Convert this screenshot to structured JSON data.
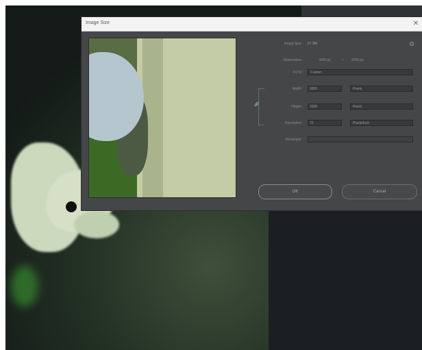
{
  "dialog": {
    "title": "Image Size",
    "close_glyph": "✕",
    "gear_glyph": "⚙",
    "rows": {
      "image_size": {
        "label": "Image Size:",
        "value": "57.9M"
      },
      "dimensions": {
        "label": "Dimensions:",
        "width": "3000 px",
        "times": "×",
        "height": "2000 px"
      },
      "fit_to": {
        "label": "Fit To:",
        "value": "Custom"
      },
      "width": {
        "label": "Width:",
        "value": "3000",
        "unit": "Pixels"
      },
      "height": {
        "label": "Height:",
        "value": "2000",
        "unit": "Pixels"
      },
      "resolution": {
        "label": "Resolution:",
        "value": "72",
        "unit": "Pixels/Inch"
      },
      "resample": {
        "label": "Resample:",
        "value": ""
      }
    },
    "buttons": {
      "ok": "OK",
      "cancel": "Cancel"
    }
  },
  "top_strip_label": "",
  "link_glyph": "🔗"
}
